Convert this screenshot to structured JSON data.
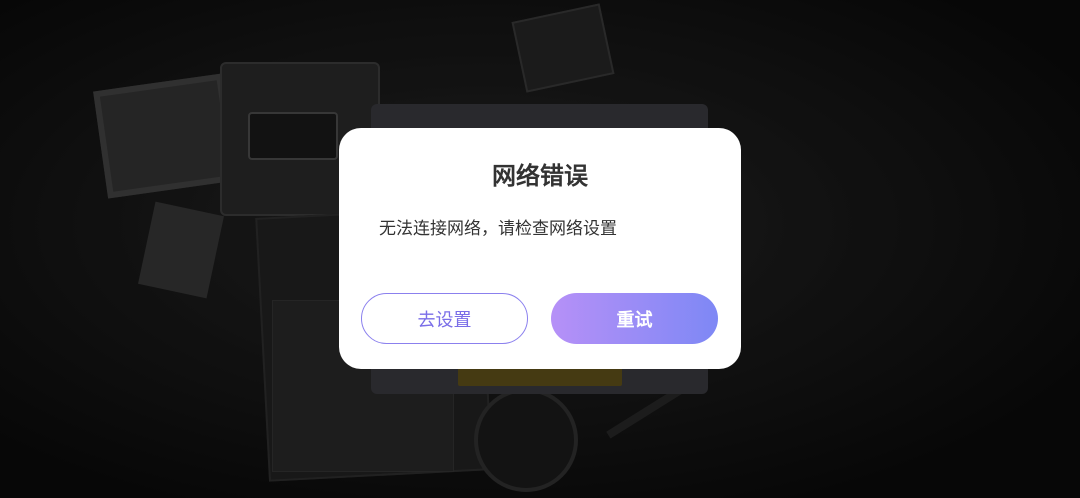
{
  "dialog": {
    "title": "网络错误",
    "message": "无法连接网络，请检查网络设置",
    "buttons": {
      "settings_label": "去设置",
      "retry_label": "重试"
    }
  },
  "colors": {
    "settings_border": "#8b80ee",
    "retry_gradient_start": "#b690f7",
    "retry_gradient_end": "#7e88f5"
  }
}
